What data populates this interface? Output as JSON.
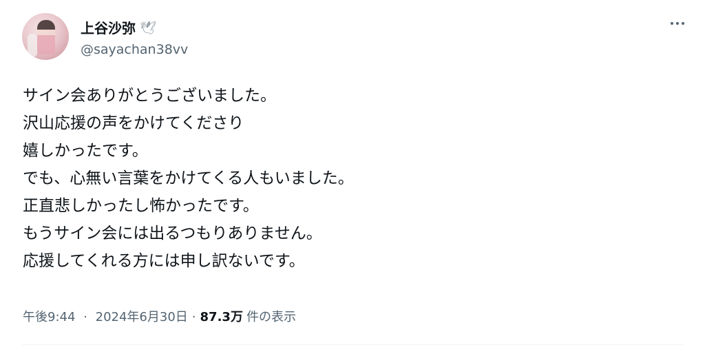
{
  "author": {
    "display_name": "上谷沙弥",
    "handle": "@sayachan38vv",
    "badge_icon": "dove-icon",
    "avatar": "profile-photo"
  },
  "more_button_icon": "more-horizontal-icon",
  "tweet": {
    "lines": [
      "サイン会ありがとうございました。",
      "沢山応援の声をかけてくださり",
      "嬉しかったです。",
      "でも、心無い言葉をかけてくる人もいました。",
      "正直悲しかったし怖かったです。",
      "もうサイン会には出るつもりありません。",
      "応援してくれる方には申し訳ないです。"
    ]
  },
  "meta": {
    "time": "午後9:44",
    "separator": "·",
    "date": "2024年6月30日",
    "views_count": "87.3万",
    "views_label": "件の表示"
  },
  "colors": {
    "text_primary": "#0f1419",
    "text_secondary": "#536471",
    "badge": "#9aa3ab"
  }
}
